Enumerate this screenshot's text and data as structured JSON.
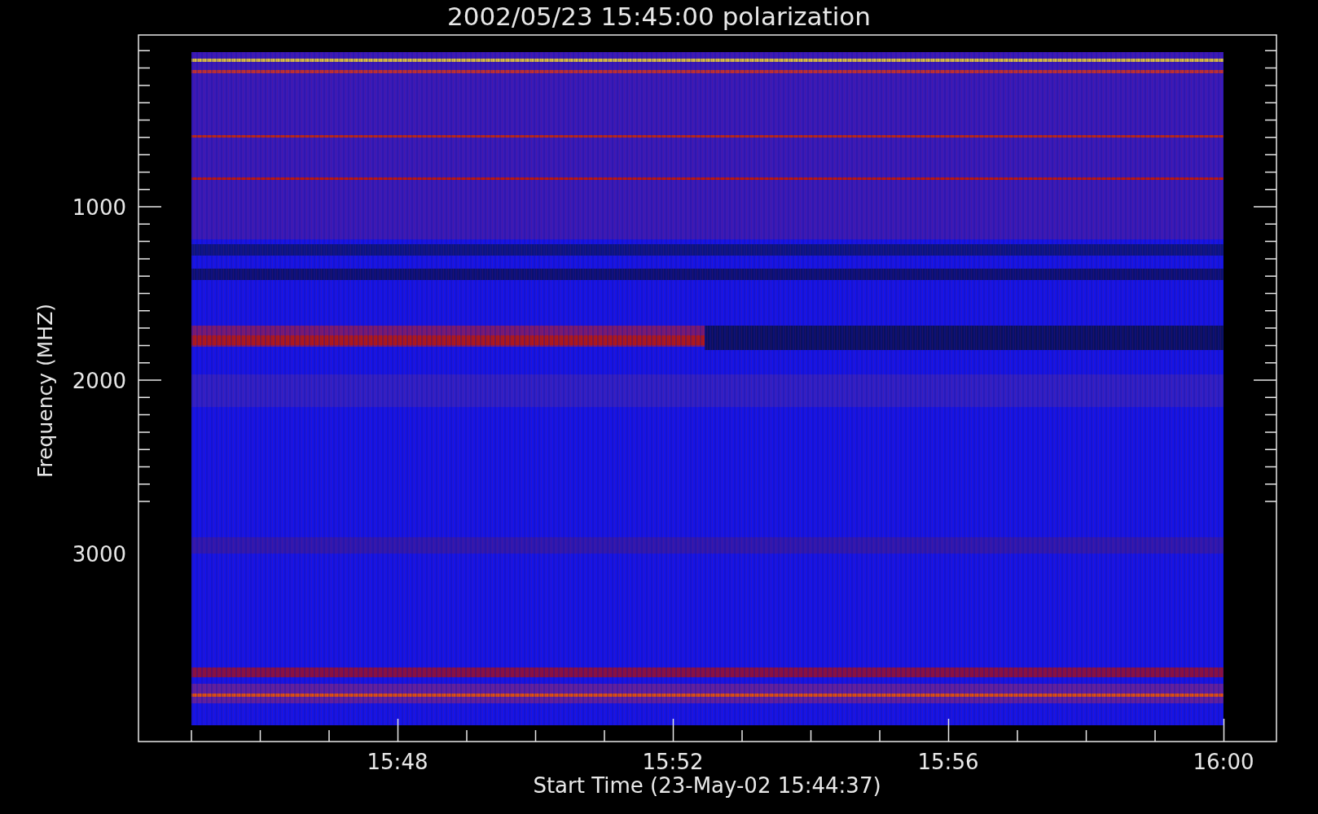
{
  "plot": {
    "title": "2002/05/23 15:45:00 polarization",
    "y_axis": {
      "label": "Frequency (MHZ)",
      "tick_labels": [
        "1000",
        "2000",
        "3000"
      ]
    },
    "x_axis": {
      "label": "Start Time (23-May-02 15:44:37)",
      "tick_labels": [
        "15:48",
        "15:52",
        "15:56",
        "16:00"
      ]
    }
  }
}
